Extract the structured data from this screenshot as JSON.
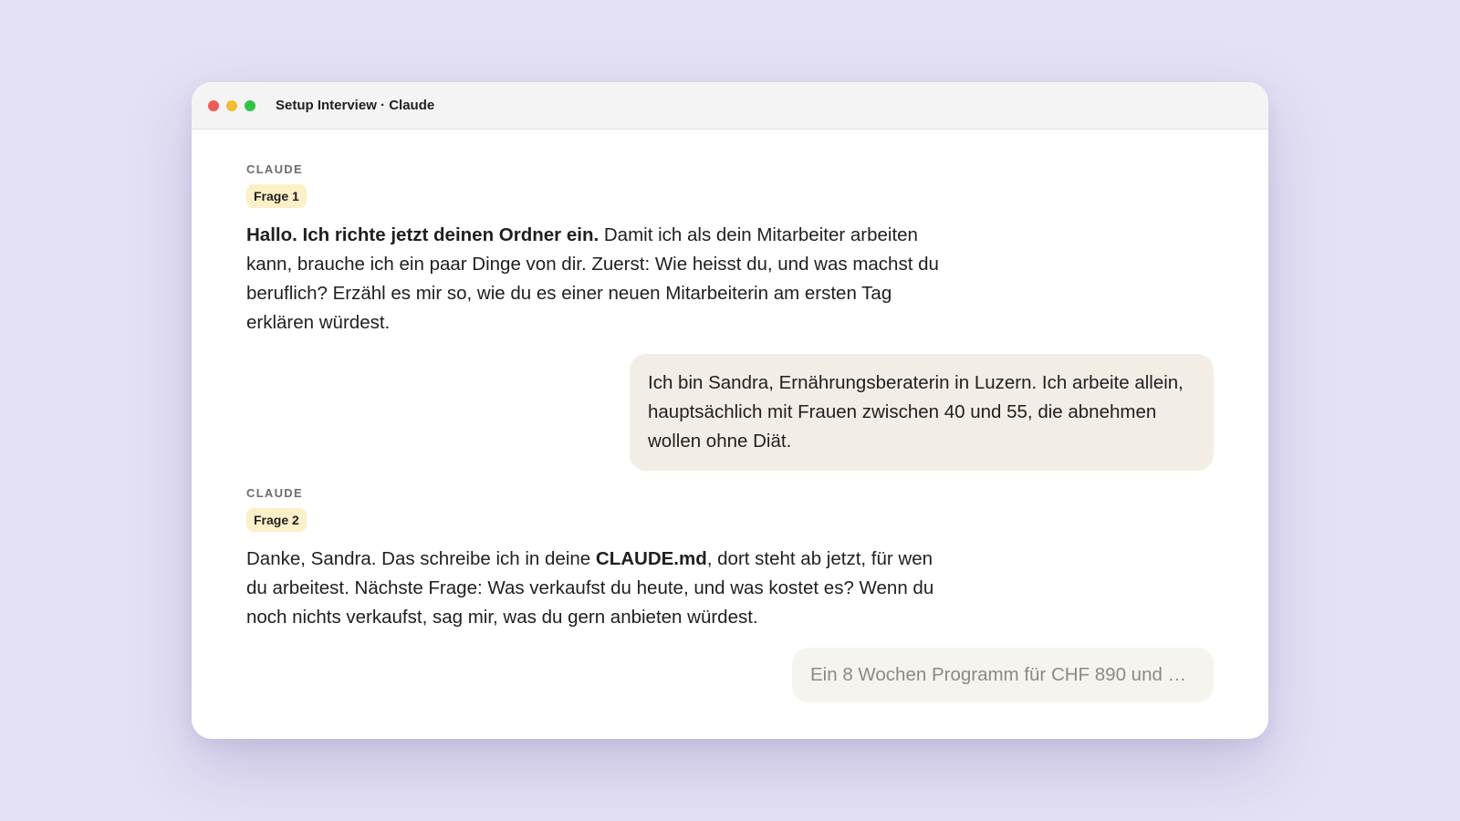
{
  "window": {
    "title": "Setup Interview · Claude"
  },
  "conversation": {
    "messages": [
      {
        "role": "assistant",
        "sender": "CLAUDE",
        "badge": "Frage 1",
        "bold_lead": "Hallo. Ich richte jetzt deinen Ordner ein.",
        "text": " Damit ich als dein Mitarbeiter arbeiten kann, brauche ich ein paar Dinge von dir. Zuerst: Wie heisst du, und was machst du beruflich? Erzähl es mir so, wie du es einer neuen Mitarbeiterin am ersten Tag erklären würdest."
      },
      {
        "role": "user",
        "text": "Ich bin Sandra, Ernährungsberaterin in Luzern. Ich arbeite allein, hauptsächlich mit Frauen zwischen 40 und 55, die abnehmen wollen ohne Diät."
      },
      {
        "role": "assistant",
        "sender": "CLAUDE",
        "badge": "Frage 2",
        "text_before": "Danke, Sandra. Das schreibe ich in deine ",
        "bold_mid": "CLAUDE.md",
        "text_after": ", dort steht ab jetzt, für wen du arbeitest. Nächste Frage: Was verkaufst du heute, und was kostet es? Wenn du noch nichts verkaufst, sag mir, was du gern anbieten würdest."
      },
      {
        "role": "user_draft",
        "text": "Ein 8 Wochen Programm für CHF 890 und …"
      }
    ]
  },
  "colors": {
    "background": "#e4e1f5",
    "badge": "#fbf0c8",
    "user_bubble": "#f3eee5",
    "traffic_red": "#ef5b57",
    "traffic_yellow": "#f3bd2f",
    "traffic_green": "#2fc446"
  }
}
